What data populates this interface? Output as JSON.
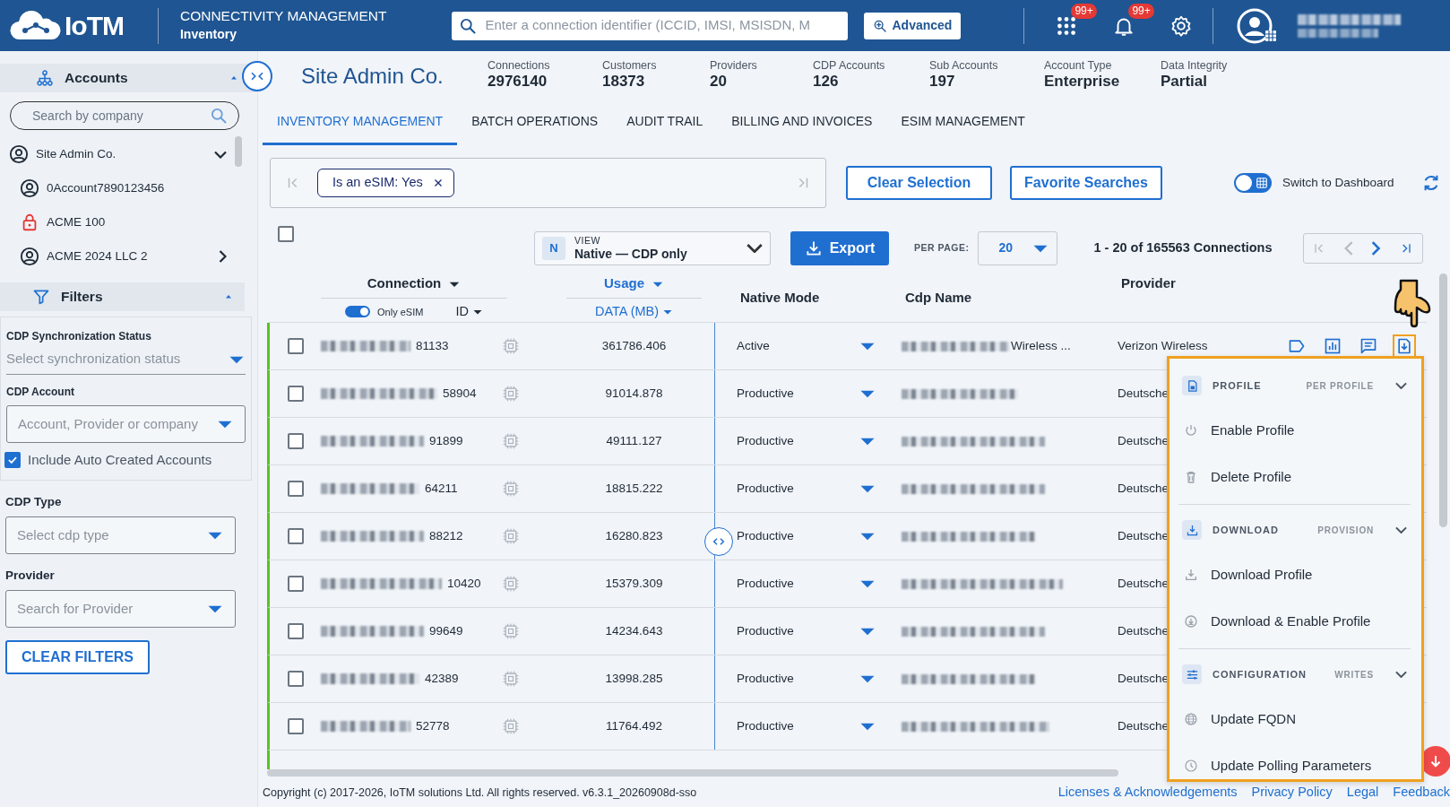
{
  "header": {
    "logo": "IoTM",
    "title": "CONNECTIVITY MANAGEMENT",
    "subtitle": "Inventory",
    "search": {
      "placeholder": "Enter a connection identifier (ICCID, IMSI, MSISDN, M"
    },
    "advanced_button": "Advanced",
    "notifications": [
      {
        "kind": "apps",
        "count": "99+"
      },
      {
        "kind": "bell",
        "count": "99+"
      }
    ]
  },
  "sidebar": {
    "accounts": {
      "title": "Accounts",
      "expanded": true,
      "search": {
        "placeholder": "Search by company"
      },
      "items": [
        {
          "label": "Site Admin Co.",
          "kind": "user",
          "expanded": true,
          "children": [
            {
              "label": "0Account7890123456",
              "kind": "user"
            },
            {
              "label": "ACME 100",
              "kind": "locked"
            },
            {
              "label": "ACME 2024 LLC 2",
              "kind": "user",
              "expanded": false
            }
          ]
        }
      ]
    },
    "filters": {
      "title": "Filters",
      "expanded": true,
      "fields": [
        {
          "kind": "underline",
          "label": "CDP Synchronization Status",
          "placeholder": "Select synchronization status"
        },
        {
          "kind": "outlined",
          "label": "CDP Account",
          "placeholder": "Account, Provider or company"
        },
        {
          "kind": "checkbox",
          "label": "Include Auto Created Accounts",
          "checked": true
        },
        {
          "kind": "outlined",
          "label": "CDP Type",
          "placeholder": "Select cdp type"
        },
        {
          "kind": "outlined",
          "label": "Provider",
          "placeholder": "Search for Provider"
        }
      ],
      "clear_button": "CLEAR FILTERS"
    }
  },
  "company": {
    "name": "Site Admin Co.",
    "stats": [
      {
        "label": "Connections",
        "value": "2976140"
      },
      {
        "label": "Customers",
        "value": "18373"
      },
      {
        "label": "Providers",
        "value": "20"
      },
      {
        "label": "CDP Accounts",
        "value": "126"
      },
      {
        "label": "Sub Accounts",
        "value": "197"
      },
      {
        "label": "Account Type",
        "value": "Enterprise"
      },
      {
        "label": "Data Integrity",
        "value": "Partial"
      }
    ]
  },
  "tabs": [
    {
      "label": "INVENTORY MANAGEMENT",
      "selected": true
    },
    {
      "label": "BATCH OPERATIONS",
      "selected": false
    },
    {
      "label": "AUDIT TRAIL",
      "selected": false
    },
    {
      "label": "BILLING AND INVOICES",
      "selected": false
    },
    {
      "label": "ESIM MANAGEMENT",
      "selected": false
    }
  ],
  "filter_bar": {
    "chips": [
      {
        "label": "Is an eSIM: Yes"
      }
    ],
    "buttons": [
      "Clear Selection",
      "Favorite Searches"
    ],
    "dashboard_switch": {
      "label": "Switch to Dashboard",
      "on": false
    }
  },
  "toolbar": {
    "select_all": {
      "checked": false
    },
    "view": {
      "badge": "N",
      "label": "VIEW",
      "value": "Native — CDP only"
    },
    "export_button": "Export",
    "per_page": {
      "label": "PER PAGE:",
      "value": "20"
    },
    "range": "1 - 20 of 165563 Connections"
  },
  "table": {
    "columns": [
      {
        "label": "Connection",
        "sub": "ID",
        "sorted": false
      },
      {
        "label": "Usage",
        "sub": "DATA (MB)",
        "sorted": true
      },
      {
        "label": "Native Mode"
      },
      {
        "label": "Cdp Name"
      },
      {
        "label": "Provider"
      }
    ],
    "only_esim": {
      "label": "Only eSIM",
      "on": true
    },
    "rows": [
      {
        "checked": false,
        "id": "81133",
        "usage": "361786.406",
        "native_mode": "Active",
        "cdp_name": "Wireless ...",
        "provider": "Verizon Wireless",
        "actions": [
          {
            "kind": "tag",
            "active": false
          },
          {
            "kind": "chart",
            "active": false
          },
          {
            "kind": "message",
            "active": false
          },
          {
            "kind": "download",
            "active": true
          }
        ]
      },
      {
        "checked": false,
        "id": "58904",
        "usage": "91014.878",
        "native_mode": "Productive",
        "provider": "Deutsche"
      },
      {
        "checked": false,
        "id": "91899",
        "usage": "49111.127",
        "native_mode": "Productive",
        "provider": "Deutsche"
      },
      {
        "checked": false,
        "id": "64211",
        "usage": "18815.222",
        "native_mode": "Productive",
        "provider": "Deutsche"
      },
      {
        "checked": false,
        "id": "88212",
        "usage": "16280.823",
        "native_mode": "Productive",
        "provider": "Deutsche"
      },
      {
        "checked": false,
        "id": "10420",
        "usage": "15379.309",
        "native_mode": "Productive",
        "provider": "Deutsche"
      },
      {
        "checked": false,
        "id": "99649",
        "usage": "14234.643",
        "native_mode": "Productive",
        "provider": "Deutsche"
      },
      {
        "checked": false,
        "id": "42389",
        "usage": "13998.285",
        "native_mode": "Productive",
        "provider": "Deutsche"
      },
      {
        "checked": false,
        "id": "52778",
        "usage": "11764.492",
        "native_mode": "Productive",
        "provider": "Deutsche"
      }
    ]
  },
  "row_menu": {
    "sections": [
      {
        "title": "PROFILE",
        "tag": "PER PROFILE",
        "kind": "sim",
        "expanded": true,
        "items": [
          {
            "label": "Enable Profile",
            "kind": "power"
          },
          {
            "label": "Delete Profile",
            "kind": "trash"
          }
        ]
      },
      {
        "title": "DOWNLOAD",
        "tag": "PROVISION",
        "kind": "download",
        "expanded": true,
        "items": [
          {
            "label": "Download Profile",
            "kind": "tray"
          },
          {
            "label": "Download & Enable Profile",
            "kind": "circle-down"
          }
        ]
      },
      {
        "title": "CONFIGURATION",
        "tag": "WRITES",
        "kind": "sliders",
        "expanded": true,
        "items": [
          {
            "label": "Update FQDN",
            "kind": "globe"
          },
          {
            "label": "Update Polling Parameters",
            "kind": "clock"
          }
        ]
      }
    ]
  },
  "footer": {
    "copyright": "Copyright (c) 2017-2026, IoTM solutions Ltd. All rights reserved. v6.3.1_20260908d-sso",
    "links": [
      "Licenses & Acknowledgements",
      "Privacy Policy",
      "Legal",
      "Feedback"
    ]
  }
}
